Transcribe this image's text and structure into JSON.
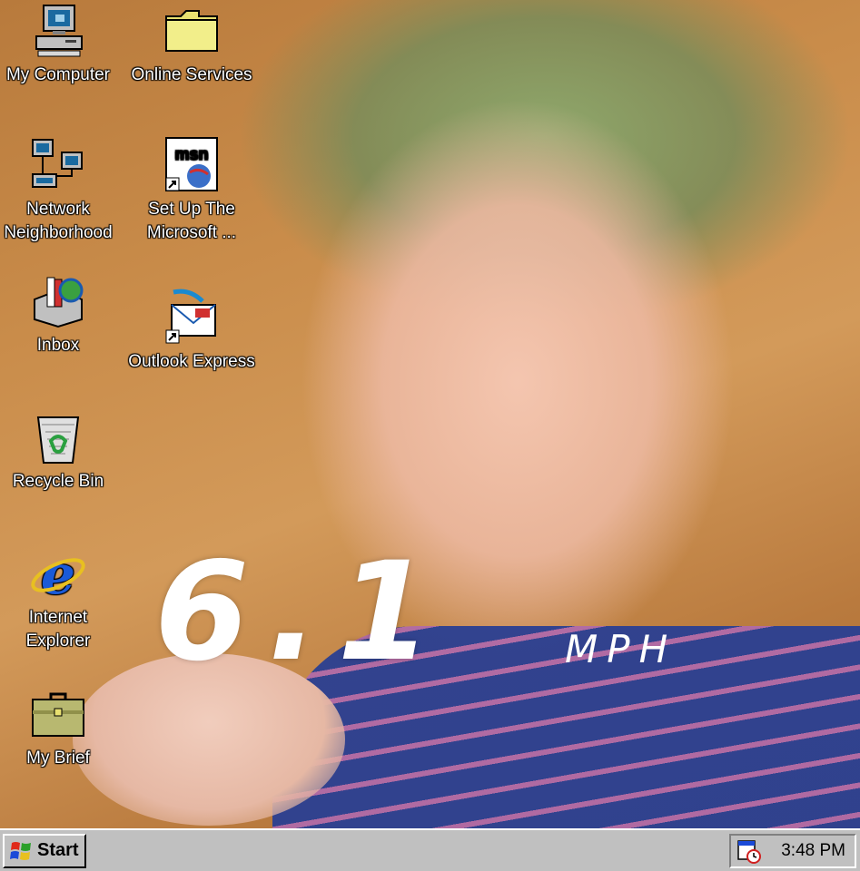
{
  "desktop": {
    "icons": [
      {
        "label": "My Computer",
        "icon": "my-computer-icon"
      },
      {
        "label": "Online Services",
        "icon": "folder-icon"
      },
      {
        "label": "Network Neighborhood",
        "icon": "network-neighborhood-icon"
      },
      {
        "label": "Set Up The Microsoft ...",
        "icon": "msn-icon"
      },
      {
        "label": "Inbox",
        "icon": "inbox-icon"
      },
      {
        "label": "Outlook Express",
        "icon": "outlook-express-icon"
      },
      {
        "label": "Recycle Bin",
        "icon": "recycle-bin-icon"
      },
      {
        "label": "Internet Explorer",
        "icon": "internet-explorer-icon"
      },
      {
        "label": "My Brief",
        "icon": "briefcase-icon"
      }
    ]
  },
  "overlay": {
    "speed_value": "6.1",
    "speed_unit": "MPH"
  },
  "taskbar": {
    "start_label": "Start",
    "clock": "3:48 PM"
  },
  "colors": {
    "taskbar_bg": "#c0c0c0",
    "label_text": "#ffffff"
  }
}
